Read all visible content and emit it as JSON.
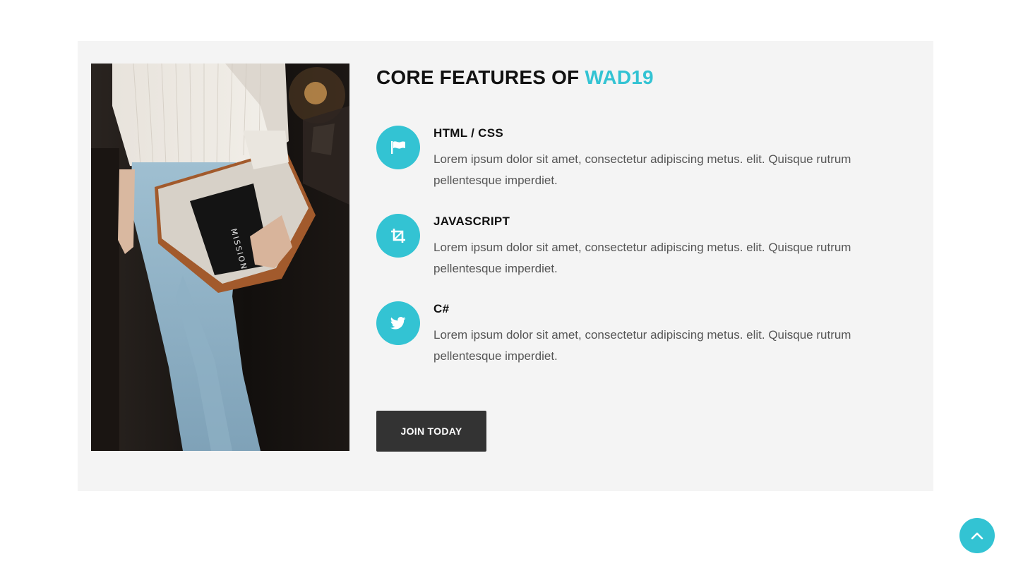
{
  "section": {
    "title_main": "CORE FEATURES OF ",
    "title_accent": "WAD19",
    "accent_color": "#33c3d3",
    "background_color": "#f4f4f4"
  },
  "photo": {
    "description_icon": "photo-woman-with-bag",
    "book_cover_text": "MISSION"
  },
  "features": [
    {
      "icon": "flag-icon",
      "title": "HTML / CSS",
      "description": "Lorem ipsum dolor sit amet, consectetur adipiscing metus. elit. Quisque rutrum pellentesque imperdiet."
    },
    {
      "icon": "crop-icon",
      "title": "JAVASCRIPT",
      "description": "Lorem ipsum dolor sit amet, consectetur adipiscing metus. elit. Quisque rutrum pellentesque imperdiet."
    },
    {
      "icon": "twitter-icon",
      "title": "C#",
      "description": "Lorem ipsum dolor sit amet, consectetur adipiscing metus. elit. Quisque rutrum pellentesque imperdiet."
    }
  ],
  "cta": {
    "label": "JOIN TODAY",
    "background_color": "#333333"
  },
  "scroll_top": {
    "icon": "chevron-up-icon"
  }
}
